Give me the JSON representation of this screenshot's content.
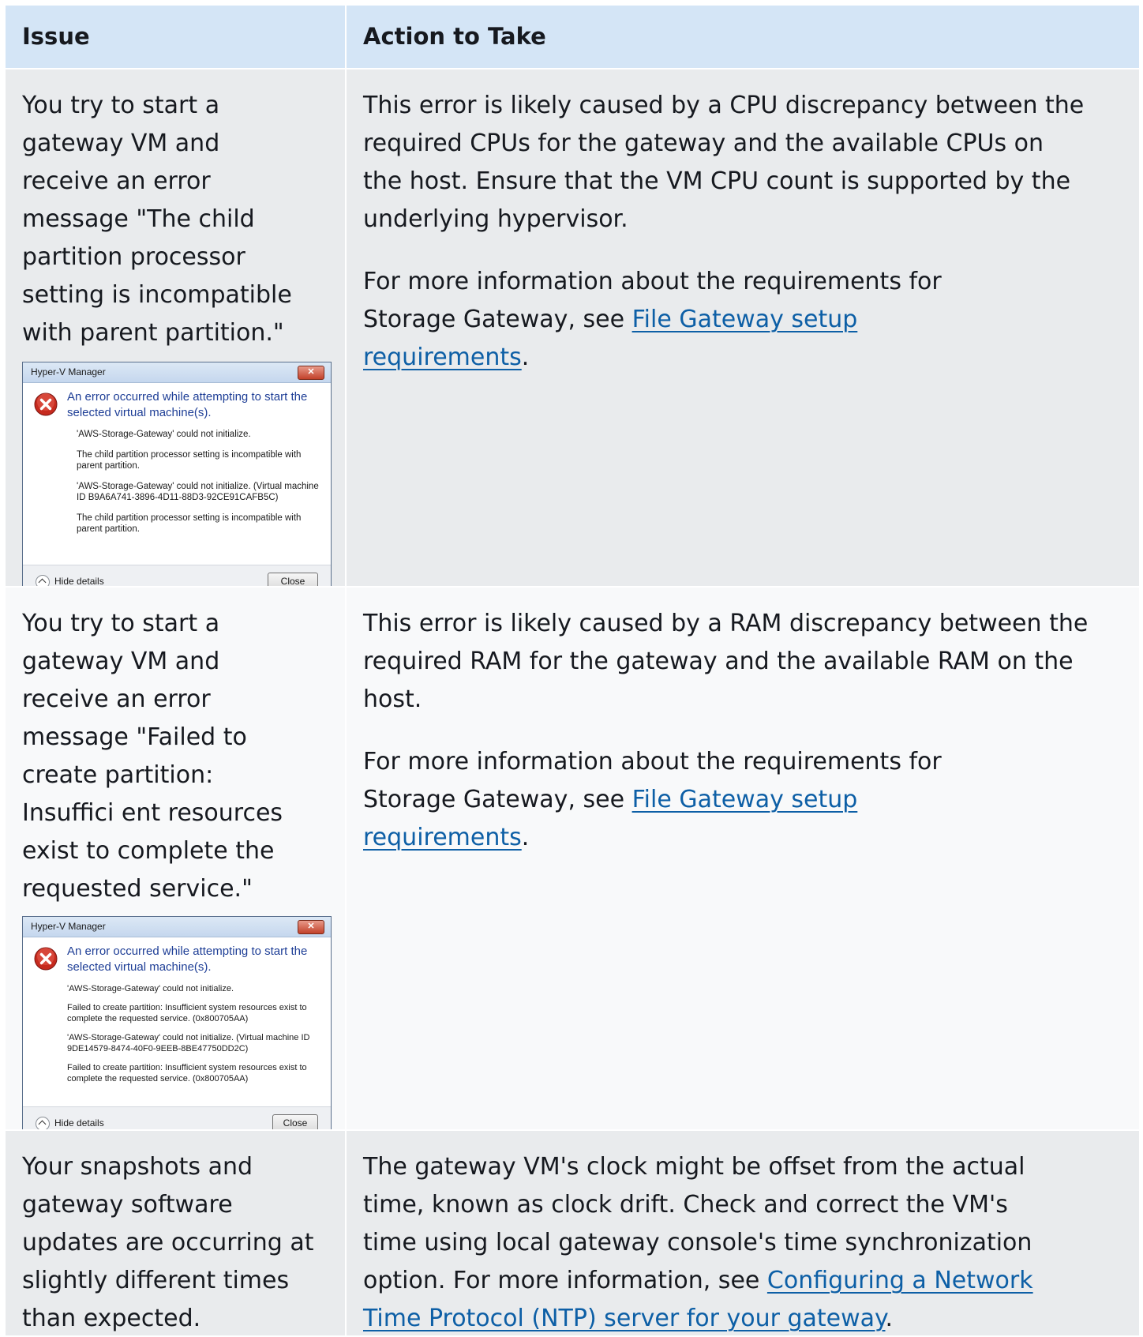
{
  "table": {
    "headers": [
      "Issue",
      "Action to Take"
    ],
    "rows": [
      {
        "issue": "You try to start a gateway VM and receive an error message \"The child partition processor setting is incompatible with parent partition.\"",
        "action_p1": "This error is likely caused by a CPU discrepancy between the required CPUs for the gateway and the available CPUs on the host. Ensure that the VM CPU count is supported by the underlying hypervisor.",
        "action_p2_prefix": "For more information about the requirements for Storage Gateway, see ",
        "action_p2_link": "File Gateway setup requirements",
        "action_p2_suffix": ".",
        "dialog": {
          "title": "Hyper-V Manager",
          "close_x": "✕",
          "main": "An error occurred while attempting to start the selected virtual machine(s).",
          "lines": [
            "'AWS-Storage-Gateway' could not initialize.",
            "The child partition processor setting is incompatible with parent partition.",
            "'AWS-Storage-Gateway' could not initialize. (Virtual machine ID B9A6A741-3896-4D11-88D3-92CE91CAFB5C)",
            "The child partition processor setting is incompatible with parent partition."
          ],
          "hide_details": "Hide details",
          "close_button": "Close"
        }
      },
      {
        "issue": "You try to start a gateway VM and receive an error message \"Failed to create partition: Insuffici ent resources exist to complete the requested service.\"",
        "action_p1": "This error is likely caused by a RAM discrepancy between the required RAM for the gateway and the available RAM on the host.",
        "action_p2_prefix": "For more information about the requirements for Storage Gateway, see ",
        "action_p2_link": "File Gateway setup requirements",
        "action_p2_suffix": ".",
        "dialog": {
          "title": "Hyper-V Manager",
          "close_x": "✕",
          "main": "An error occurred while attempting to start the selected virtual machine(s).",
          "lines": [
            "'AWS-Storage-Gateway' could not initialize.",
            "Failed to create partition: Insufficient system resources exist to complete the requested service. (0x800705AA)",
            "'AWS-Storage-Gateway' could not initialize. (Virtual machine ID 9DE14579-8474-40F0-9EEB-8BE47750DD2C)",
            "Failed to create partition: Insufficient system resources exist to complete the requested service. (0x800705AA)"
          ],
          "hide_details": "Hide details",
          "close_button": "Close"
        }
      },
      {
        "issue": "Your snapshots and gateway software updates are occurring at slightly different times than expected.",
        "action_p1_prefix": "The gateway VM's clock might be offset from the actual time, known as clock drift. Check and correct the VM's time using local gateway console's time synchronization option. For more information, see ",
        "action_p1_link": "Configuring a Network Time Protocol (NTP) server for your gateway",
        "action_p1_suffix": "."
      }
    ]
  },
  "colors": {
    "header_bg": "#d4e5f6",
    "row_odd_bg": "#e9ebed",
    "row_even_bg": "#f8f9fa",
    "link": "#0d5fa6",
    "dialog_heading": "#1e3e96"
  }
}
